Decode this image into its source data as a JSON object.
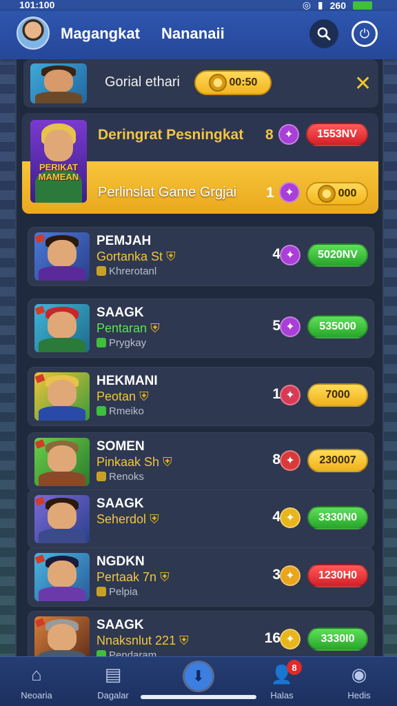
{
  "status": {
    "time": "101:100",
    "right_text": "260"
  },
  "header": {
    "title1": "Magangkat",
    "title2": "Nananaii"
  },
  "top_banner": {
    "label": "Gorial ethari",
    "coin_value": "00:50"
  },
  "featured": {
    "title": "Deringrat Pesningkat",
    "title_rank": "8",
    "title_badge": "1553NV",
    "subtitle": "Perlinslat Game Grgjai",
    "sub_rank": "1",
    "sub_value": "000",
    "thumb_text1": "PERIKAT",
    "thumb_text2": "MAMEAN"
  },
  "items": [
    {
      "name": "PEMJAH",
      "sub1": "Gortanka St",
      "sub2": "Khrerotanl",
      "rank": "4",
      "value": "5020NV",
      "pill": "green",
      "gem": "#a93ed8",
      "sub1_color": "#f4c540",
      "sub2_check": "#c9a027"
    },
    {
      "name": "SAAGK",
      "sub1": "Pentaran",
      "sub2": "Prygkay",
      "rank": "5",
      "value": "535000",
      "pill": "green",
      "gem": "#a93ed8",
      "sub1_color": "#5fe05a",
      "sub2_check": "#3fbf3a"
    },
    {
      "name": "HEKMANI",
      "sub1": "Peotan",
      "sub2": "Rmeiko",
      "rank": "1",
      "value": "7000",
      "pill": "yellow",
      "gem": "#d83a55",
      "sub1_color": "#f4c540",
      "sub2_check": "#3fbf3a"
    },
    {
      "name": "SOMEN",
      "sub1": "Pinkaak Sh",
      "sub2": "Renoks",
      "rank": "8",
      "value": "230007",
      "pill": "yellow",
      "gem": "#d83a3a",
      "sub1_color": "#f4c540",
      "sub2_check": "#c9a027"
    },
    {
      "name": "SAAGK",
      "sub1": "Seherdol",
      "sub2": "",
      "rank": "4",
      "value": "3330N0",
      "pill": "green",
      "gem": "#e8b51d",
      "sub1_color": "#f4c540",
      "sub2_check": ""
    },
    {
      "name": "NGDKN",
      "sub1": "Pertaak 7n",
      "sub2": "Pelpia",
      "rank": "3",
      "value": "1230H0",
      "pill": "red",
      "gem": "#e8a51d",
      "sub1_color": "#f4c540",
      "sub2_check": "#c9a027"
    },
    {
      "name": "SAAGK",
      "sub1": "Nnaksnlut 221",
      "sub2": "Pendaram",
      "rank": "16",
      "value": "3330I0",
      "pill": "green",
      "gem": "#e8b51d",
      "sub1_color": "#f4c540",
      "sub2_check": "#3fbf3a"
    }
  ],
  "nav": [
    {
      "label": "Neoaria",
      "icon": "home-icon"
    },
    {
      "label": "Dagalar",
      "icon": "document-icon"
    },
    {
      "label": "",
      "icon": "download-icon"
    },
    {
      "label": "Halas",
      "icon": "user-icon",
      "badge": "8"
    },
    {
      "label": "Hedis",
      "icon": "profile-icon"
    }
  ]
}
